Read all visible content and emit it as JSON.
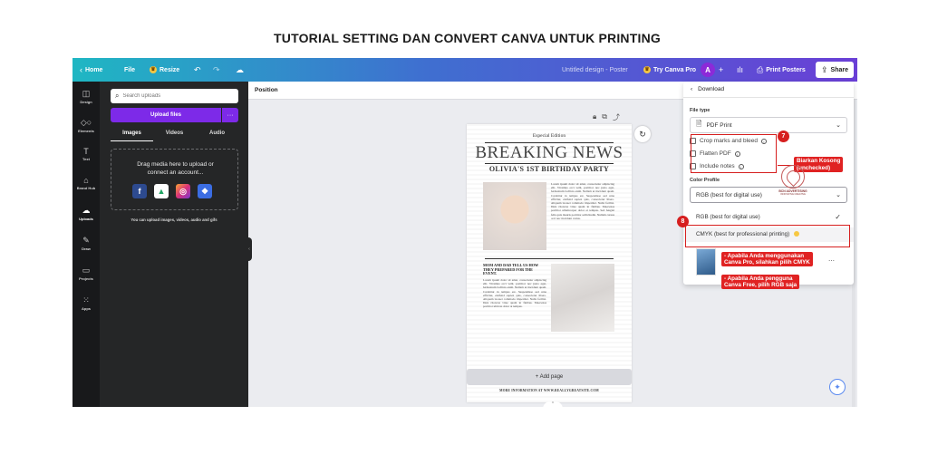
{
  "page_title": "TUTORIAL SETTING DAN CONVERT CANVA UNTUK PRINTING",
  "topbar": {
    "home": "Home",
    "file": "File",
    "resize": "Resize",
    "design_title": "Untitled design - Poster",
    "try_pro": "Try Canva Pro",
    "avatar": "A",
    "print_posters": "Print Posters",
    "share": "Share"
  },
  "rail": {
    "items": [
      {
        "label": "Design",
        "icon": "layout-icon"
      },
      {
        "label": "Elements",
        "icon": "shapes-icon"
      },
      {
        "label": "Text",
        "icon": "text-icon"
      },
      {
        "label": "Brand Hub",
        "icon": "brand-icon"
      },
      {
        "label": "Uploads",
        "icon": "cloud-upload-icon"
      },
      {
        "label": "Draw",
        "icon": "pen-icon"
      },
      {
        "label": "Projects",
        "icon": "folder-icon"
      },
      {
        "label": "Apps",
        "icon": "grid-icon"
      }
    ]
  },
  "uploads": {
    "search_placeholder": "Search uploads",
    "upload_button": "Upload files",
    "more": "···",
    "tabs": [
      "Images",
      "Videos",
      "Audio"
    ],
    "dropzone_text": "Drag media here to upload or connect an account...",
    "hint": "You can upload images, videos, audio and gifs"
  },
  "canvas": {
    "position_label": "Position",
    "add_page": "+ Add page"
  },
  "poster": {
    "edition": "Especial Edition",
    "headline": "BREAKING NEWS",
    "subheadline": "OLIVIA'S 1ST BIRTHDAY PARTY",
    "body1": "Lorem ipsum dolor sit amet, consectetur adipiscing elit. Vivamus orci velit, porttitor nec justo eget, fermentum facilisis enim. Nullam ut tincidunt quam. Curabitur in tempus est. Suspendisse sed urna efficitur, eleifend sapien quis, consectetur libero. Aliquam laoreet commodo imperdiet. Nulla facilisi. Duis rhoncus vitae quam in finibus. Maecenas porttitor ullamcorper dolor at tempus. Sed feugiat felis quis mauris porttitor sollicitudin. Nullam cursus orci nec tincidunt varius.",
    "headline2": "MOM AND DAD TELL US HOW THEY PREPARED FOR THE EVENT.",
    "body2": "Lorem ipsum dolor sit amet, consectetur adipiscing elit. Vivamus orci velit, porttitor nec justo eget, fermentum facilisis enim. Nullam ut tincidunt quam. Curabitur in tempus est. Suspendisse sed urna efficitur, eleifend sapien quis, consectetur libero. Aliquam laoreet commodo imperdiet. Nulla facilisi. Duis rhoncus vitae quam in finibus. Maecenas porttitor ultrices dolor at tempus.",
    "footer": "MORE INFORMATION AT WWW.REALLYGREATSITE.COM"
  },
  "download": {
    "back_label": "Download",
    "file_type_label": "File type",
    "file_type_value": "PDF Print",
    "options": [
      "Crop marks and bleed",
      "Flatten PDF",
      "Include notes"
    ],
    "color_profile_label": "Color Profile",
    "color_profile_value": "RGB (best for digital use)",
    "profile_options": [
      "RGB (best for digital use)",
      "CMYK (best for professional printing)"
    ]
  },
  "annotations": {
    "step7": "7",
    "step8": "8",
    "note_unchecked_1": "Biarkan Kosong",
    "note_unchecked_2": "(unchecked)",
    "note_pro_1": "- Apabila Anda menggunakan",
    "note_pro_2": "Canva Pro, silahkan pilih CMYK",
    "note_free_1": "- Apabila Anda pengguna",
    "note_free_2": "Canva Free, pilih RGB saja",
    "logo_text": "BCN ADVERTISING",
    "logo_subtext": "INNOVATIVE CREATIVE"
  },
  "colors": {
    "accent": "#7d2ae8",
    "annotation_red": "#d61f1f",
    "topbar_start": "#1fb7c3",
    "topbar_end": "#6a3fd6"
  }
}
